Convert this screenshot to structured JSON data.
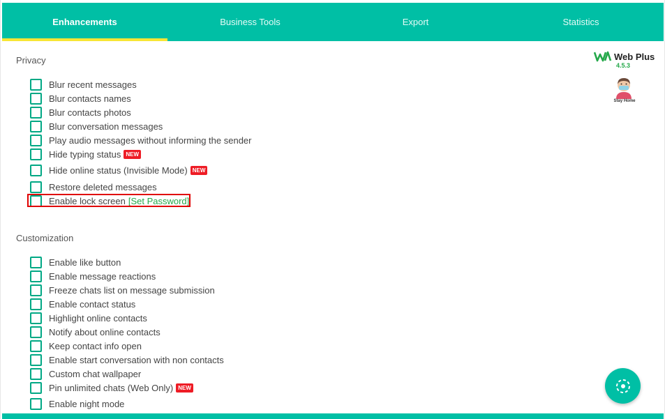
{
  "tabs": [
    {
      "label": "Enhancements",
      "active": true
    },
    {
      "label": "Business Tools",
      "active": false
    },
    {
      "label": "Export",
      "active": false
    },
    {
      "label": "Statistics",
      "active": false
    }
  ],
  "brand": {
    "name": "Web Plus",
    "version": "4.5.3",
    "tagline": "Stay Home"
  },
  "privacy": {
    "title": "Privacy",
    "options": [
      {
        "label": "Blur recent messages"
      },
      {
        "label": "Blur contacts names"
      },
      {
        "label": "Blur contacts photos"
      },
      {
        "label": "Blur conversation messages"
      },
      {
        "label": "Play audio messages without informing the sender"
      },
      {
        "label": "Hide typing status",
        "badge": "NEW"
      },
      {
        "label": "Hide online status (Invisible Mode)",
        "badge": "NEW"
      },
      {
        "label": "Restore deleted messages"
      },
      {
        "label": "Enable lock screen",
        "link": "[Set Password]"
      }
    ]
  },
  "customization": {
    "title": "Customization",
    "options": [
      {
        "label": "Enable like button"
      },
      {
        "label": "Enable message reactions"
      },
      {
        "label": "Freeze chats list on message submission"
      },
      {
        "label": "Enable contact status"
      },
      {
        "label": "Highlight online contacts"
      },
      {
        "label": "Notify about online contacts"
      },
      {
        "label": "Keep contact info open"
      },
      {
        "label": "Enable start conversation with non contacts"
      },
      {
        "label": "Custom chat wallpaper"
      },
      {
        "label": "Pin unlimited chats (Web Only)",
        "badge": "NEW"
      },
      {
        "label": "Enable night mode"
      }
    ]
  },
  "colors": {
    "accent": "#00bfa5",
    "tab_indicator": "#f7e535",
    "badge": "#ee1c25",
    "link": "#24a84a"
  },
  "icons": {
    "fab": "target-icon"
  }
}
